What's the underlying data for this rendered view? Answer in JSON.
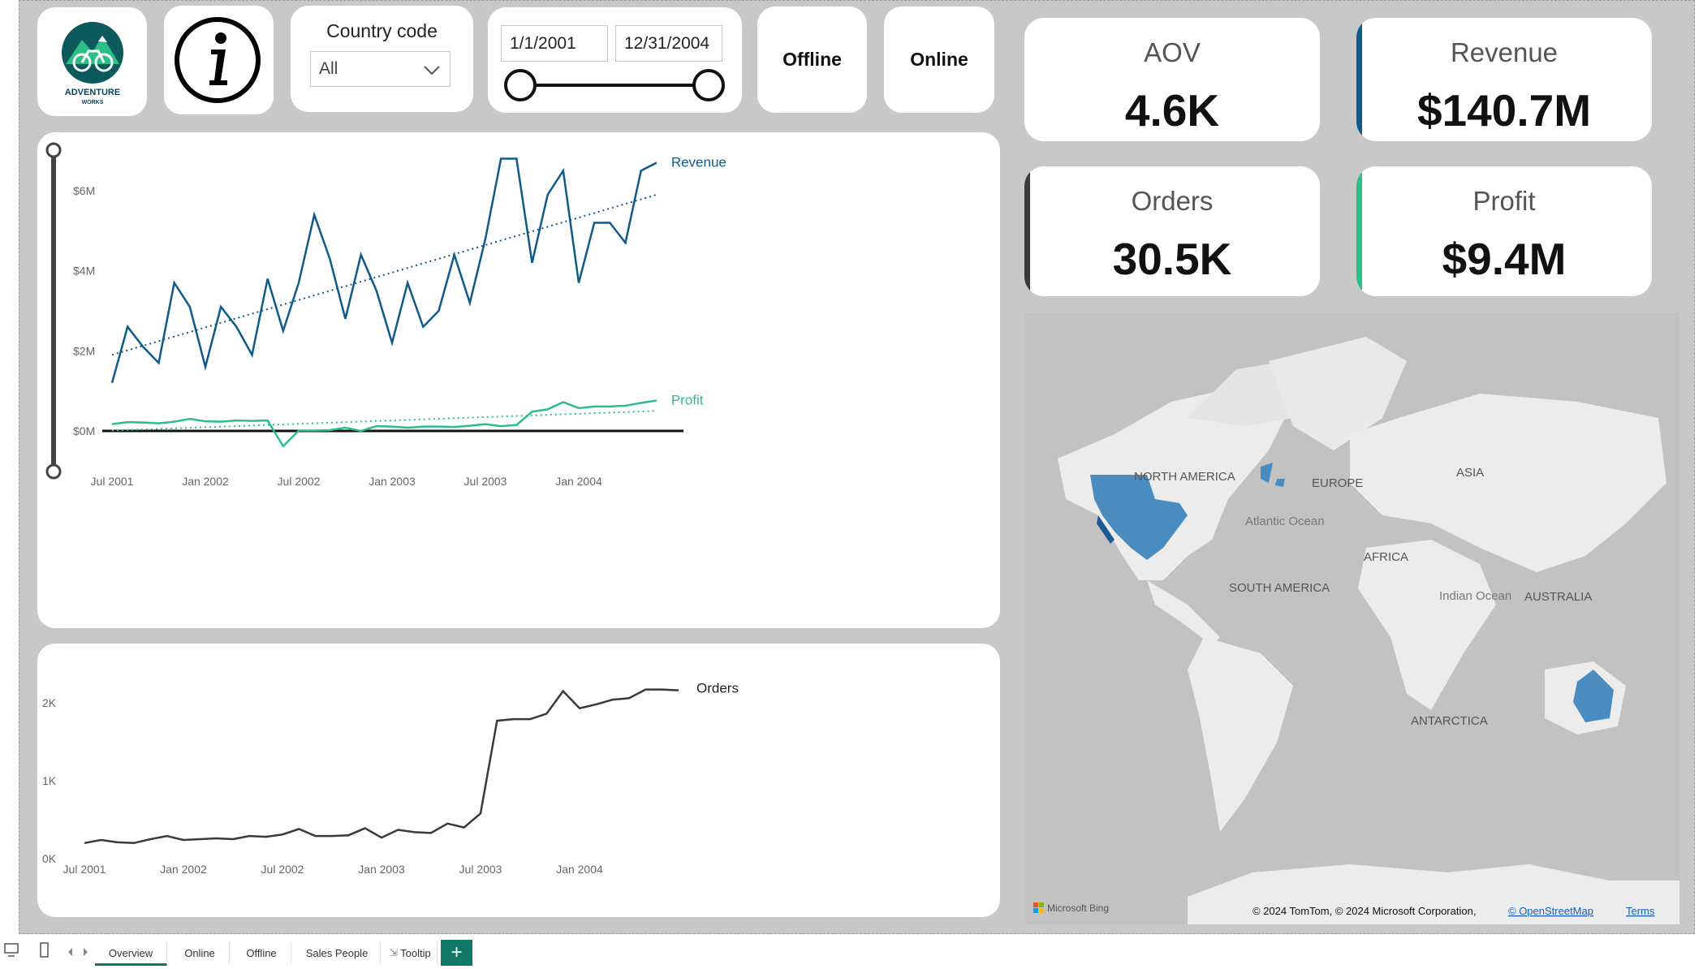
{
  "filters": {
    "country_label": "Country code",
    "country_value": "All",
    "date_start": "1/1/2001",
    "date_end": "12/31/2004",
    "offline_label": "Offline",
    "online_label": "Online"
  },
  "logo": {
    "text_line1": "ADVENTURE",
    "text_line2": "WORKS"
  },
  "kpis": {
    "aov_label": "AOV",
    "aov_value": "4.6K",
    "revenue_label": "Revenue",
    "revenue_value": "$140.7M",
    "orders_label": "Orders",
    "orders_value": "30.5K",
    "profit_label": "Profit",
    "profit_value": "$9.4M"
  },
  "colors": {
    "revenue": "#0e5a8a",
    "profit": "#2bbf88",
    "orders": "#3a3a3a",
    "tab_active": "#117865"
  },
  "map": {
    "labels": [
      "NORTH AMERICA",
      "EUROPE",
      "ASIA",
      "Atlantic Ocean",
      "AFRICA",
      "SOUTH AMERICA",
      "Indian Ocean",
      "AUSTRALIA",
      "ANTARCTICA"
    ],
    "attribution": "© 2024 TomTom, © 2024 Microsoft Corporation,",
    "osm_link": "© OpenStreetMap",
    "terms_link": "Terms",
    "bing_label": "Microsoft Bing"
  },
  "tabs": [
    "Overview",
    "Online",
    "Offline",
    "Sales People",
    "Tooltip"
  ],
  "add_tab": "+",
  "chart_data": [
    {
      "type": "line",
      "title": "",
      "x": [
        "Jul 2001",
        "Aug 2001",
        "Sep 2001",
        "Oct 2001",
        "Nov 2001",
        "Dec 2001",
        "Jan 2002",
        "Feb 2002",
        "Mar 2002",
        "Apr 2002",
        "May 2002",
        "Jun 2002",
        "Jul 2002",
        "Aug 2002",
        "Sep 2002",
        "Oct 2002",
        "Nov 2002",
        "Dec 2002",
        "Jan 2003",
        "Feb 2003",
        "Mar 2003",
        "Apr 2003",
        "May 2003",
        "Jun 2003",
        "Jul 2003",
        "Aug 2003",
        "Sep 2003",
        "Oct 2003",
        "Nov 2003",
        "Dec 2003",
        "Jan 2004",
        "Feb 2004",
        "Mar 2004",
        "Apr 2004",
        "May 2004",
        "Jun 2004",
        "Jul 2004"
      ],
      "x_tick_labels": [
        "Jul 2001",
        "Jan 2002",
        "Jul 2002",
        "Jan 2003",
        "Jul 2003",
        "Jan 2004"
      ],
      "y_tick_labels": [
        "$0M",
        "$2M",
        "$4M",
        "$6M"
      ],
      "ylim": [
        0,
        7000000
      ],
      "series": [
        {
          "name": "Revenue",
          "values": [
            1200000,
            2600000,
            2100000,
            1700000,
            3700000,
            3100000,
            1600000,
            3100000,
            2600000,
            1900000,
            3800000,
            2500000,
            3700000,
            5400000,
            4300000,
            2800000,
            4400000,
            3500000,
            2200000,
            3700000,
            2600000,
            3000000,
            4400000,
            3200000,
            4800000,
            6800000,
            6800000,
            4200000,
            5900000,
            6500000,
            3700000,
            5200000,
            5200000,
            4700000,
            6500000,
            6700000,
            null
          ],
          "trend": [
            1900000,
            5900000
          ]
        },
        {
          "name": "Profit",
          "values": [
            170000,
            220000,
            210000,
            190000,
            230000,
            300000,
            240000,
            230000,
            260000,
            250000,
            260000,
            -380000,
            10000,
            10000,
            20000,
            80000,
            0,
            120000,
            110000,
            80000,
            110000,
            110000,
            100000,
            130000,
            170000,
            120000,
            150000,
            480000,
            540000,
            720000,
            570000,
            610000,
            610000,
            630000,
            700000,
            760000,
            null
          ],
          "trend": [
            10000,
            500000
          ]
        }
      ]
    },
    {
      "type": "line",
      "title": "",
      "x": [
        "Jul 2001",
        "Aug 2001",
        "Sep 2001",
        "Oct 2001",
        "Nov 2001",
        "Dec 2001",
        "Jan 2002",
        "Feb 2002",
        "Mar 2002",
        "Apr 2002",
        "May 2002",
        "Jun 2002",
        "Jul 2002",
        "Aug 2002",
        "Sep 2002",
        "Oct 2002",
        "Nov 2002",
        "Dec 2002",
        "Jan 2003",
        "Feb 2003",
        "Mar 2003",
        "Apr 2003",
        "May 2003",
        "Jun 2003",
        "Jul 2003",
        "Aug 2003",
        "Sep 2003",
        "Oct 2003",
        "Nov 2003",
        "Dec 2003",
        "Jan 2004",
        "Feb 2004",
        "Mar 2004",
        "Apr 2004",
        "May 2004",
        "Jun 2004",
        "Jul 2004"
      ],
      "x_tick_labels": [
        "Jul 2001",
        "Jan 2002",
        "Jul 2002",
        "Jan 2003",
        "Jul 2003",
        "Jan 2004"
      ],
      "y_tick_labels": [
        "0K",
        "1K",
        "2K"
      ],
      "ylim": [
        0,
        2000
      ],
      "series": [
        {
          "name": "Orders",
          "values": [
            200,
            240,
            210,
            200,
            250,
            290,
            240,
            250,
            260,
            250,
            290,
            280,
            310,
            380,
            290,
            290,
            300,
            390,
            270,
            370,
            340,
            330,
            450,
            400,
            580,
            1770,
            1790,
            1790,
            1860,
            2150,
            1930,
            1980,
            2040,
            2060,
            2170,
            2170,
            2160
          ]
        }
      ]
    }
  ]
}
